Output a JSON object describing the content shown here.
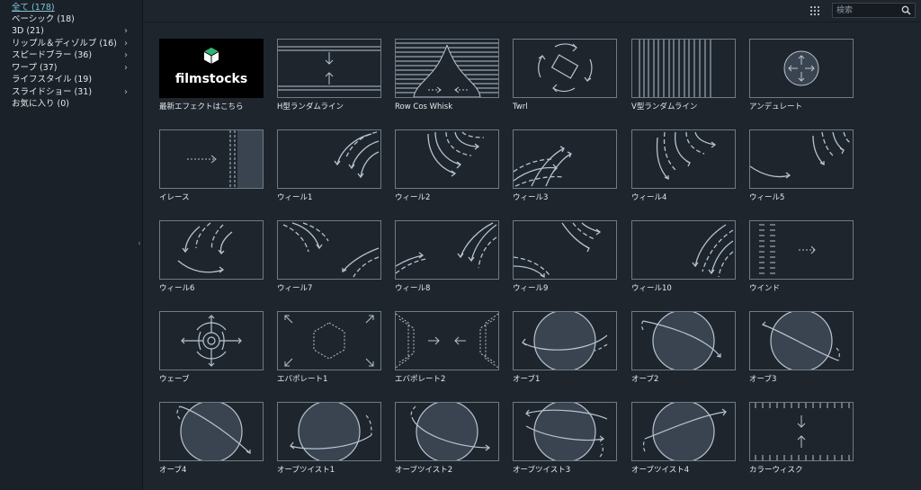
{
  "sidebar": {
    "categories": [
      {
        "label": "全て (178)"
      },
      {
        "label": "ベーシック (18)"
      },
      {
        "label": "3D (21)"
      },
      {
        "label": "リップル＆ディゾルブ (16)"
      },
      {
        "label": "スピードブラー (36)"
      },
      {
        "label": "ワープ (37)"
      },
      {
        "label": "ライフスタイル (19)"
      },
      {
        "label": "スライドショー (31)"
      },
      {
        "label": "お気に入り (0)"
      }
    ],
    "chevron": "›",
    "collapse_glyph": "‹"
  },
  "toolbar": {
    "search_placeholder": "検索",
    "icons": [
      "grid-view-icon",
      "search-icon"
    ]
  },
  "logo": {
    "brand": "filmstocks"
  },
  "colors": {
    "background": "#1e252d",
    "line": "#b7c4d1",
    "accent": "#7fc4d6"
  },
  "transitions": [
    {
      "label": "最新エフェクトはこちら",
      "icon": "filmstocks-logo"
    },
    {
      "label": "H型ランダムライン",
      "icon": "h-random-line-icon"
    },
    {
      "label": "Row Cos Whisk",
      "icon": "row-cos-whisk-icon"
    },
    {
      "label": "Twrl",
      "icon": "twirl-icon"
    },
    {
      "label": "V型ランダムライン",
      "icon": "v-random-line-icon"
    },
    {
      "label": "アンデュレート",
      "icon": "undulate-icon"
    },
    {
      "label": "イレース",
      "icon": "erase-icon"
    },
    {
      "label": "ウィール1",
      "icon": "wheel-icon"
    },
    {
      "label": "ウィール2",
      "icon": "wheel-icon"
    },
    {
      "label": "ウィール3",
      "icon": "wheel-icon"
    },
    {
      "label": "ウィール4",
      "icon": "wheel-icon"
    },
    {
      "label": "ウィール5",
      "icon": "wheel-icon"
    },
    {
      "label": "ウィール6",
      "icon": "wheel-icon"
    },
    {
      "label": "ウィール7",
      "icon": "wheel-icon"
    },
    {
      "label": "ウィール8",
      "icon": "wheel-icon"
    },
    {
      "label": "ウィール9",
      "icon": "wheel-icon"
    },
    {
      "label": "ウィール10",
      "icon": "wheel-icon"
    },
    {
      "label": "ウインド",
      "icon": "wind-icon"
    },
    {
      "label": "ウェーブ",
      "icon": "wave-icon"
    },
    {
      "label": "エバポレート1",
      "icon": "evaporate-icon"
    },
    {
      "label": "エバポレート2",
      "icon": "evaporate-icon"
    },
    {
      "label": "オーブ1",
      "icon": "orb-icon"
    },
    {
      "label": "オーブ2",
      "icon": "orb-icon"
    },
    {
      "label": "オーブ3",
      "icon": "orb-icon"
    },
    {
      "label": "オーブ4",
      "icon": "orb-icon"
    },
    {
      "label": "オーブツイスト1",
      "icon": "orb-twist-icon"
    },
    {
      "label": "オーブツイスト2",
      "icon": "orb-twist-icon"
    },
    {
      "label": "オーブツイスト3",
      "icon": "orb-twist-icon"
    },
    {
      "label": "オーブツイスト4",
      "icon": "orb-twist-icon"
    },
    {
      "label": "カラーウィスク",
      "icon": "color-whisk-icon"
    }
  ]
}
